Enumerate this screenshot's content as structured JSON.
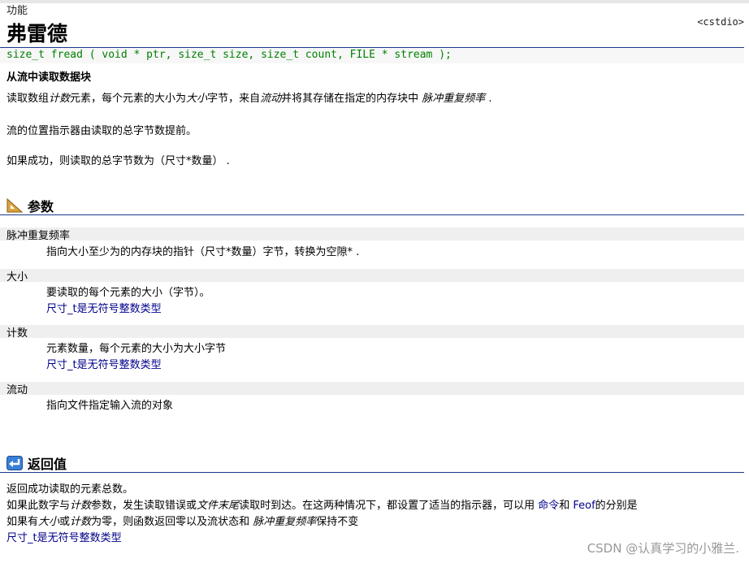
{
  "header": {
    "kind": "功能",
    "title": "弗雷德",
    "header_file": "<cstdio>"
  },
  "prototype": "size_t fread ( void * ptr, size_t size, size_t count, FILE * stream );",
  "summary": "从流中读取数据块",
  "description": {
    "p1": {
      "a": "读取数组",
      "b": "计数",
      "c": "元素，每个元素的大小为",
      "d": "大小",
      "e": "字节，来自",
      "f": "流动",
      "g": "并将其存储在指定的内存块中 ",
      "h": "脉冲重复频率",
      "i": " ."
    },
    "p2": "流的位置指示器由读取的总字节数提前。",
    "p3": "如果成功，则读取的总字节数为（尺寸*数量） ."
  },
  "parameters": {
    "heading": "参数",
    "items": [
      {
        "name": "脉冲重复频率",
        "lines": [
          "指向大小至少为的内存块的指针（尺寸*数量）字节，转换为空隙* ."
        ]
      },
      {
        "name": "大小",
        "lines": [
          "要读取的每个元素的大小（字节）。",
          "尺寸_t是无符号整数类型"
        ]
      },
      {
        "name": "计数",
        "lines": [
          "元素数量，每个元素的大小为大小字节",
          "尺寸_t是无符号整数类型"
        ]
      },
      {
        "name": "流动",
        "lines": [
          "指向文件指定输入流的对象"
        ]
      }
    ]
  },
  "return_value": {
    "heading": "返回值",
    "l1": "返回成功读取的元素总数。",
    "l2": {
      "a": "如果此数字与",
      "b": "计数",
      "c": "参数，发生读取错误或",
      "d": "文件末尾",
      "e": "读取时到达。在这两种情况下，都设置了适当的指示器，可以用 ",
      "f": "命令",
      "g": "和 ",
      "h": "Feof",
      "i": "的分别是"
    },
    "l3": {
      "a": "如果有",
      "b": "大小",
      "c": "或",
      "d": "计数",
      "e": "为零，则函数返回零以及流状态和 ",
      "f": "脉冲重复频率",
      "g": "保持不变"
    },
    "l4": "尺寸_t是无符号整数类型"
  },
  "watermark": "CSDN @认真学习的小雅兰."
}
